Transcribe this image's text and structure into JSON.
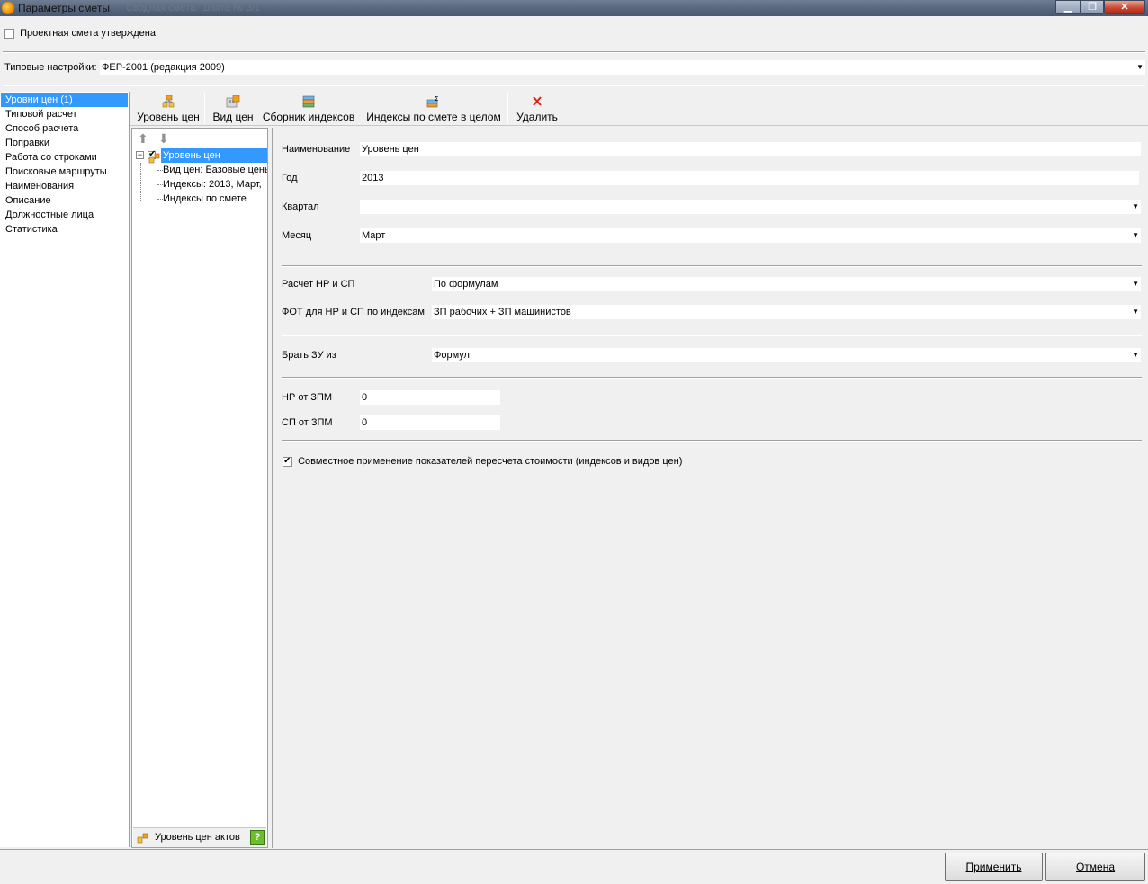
{
  "window": {
    "title": "Параметры сметы",
    "title_ghost": "Сводная смета. Шахта № 3/1"
  },
  "approved": {
    "label": "Проектная смета утверждена",
    "checked": false
  },
  "typical_settings": {
    "label": "Типовые настройки:",
    "value": "ФЕР-2001 (редакция 2009)"
  },
  "nav": {
    "items": [
      "Уровни цен (1)",
      "Типовой расчет",
      "Способ расчета",
      "Поправки",
      "Работа со строками",
      "Поисковые маршруты",
      "Наименования",
      "Описание",
      "Должностные лица",
      "Статистика"
    ]
  },
  "toolbar": {
    "price_level": "Уровень цен",
    "price_type": "Вид цен",
    "index_collection": "Сборник индексов",
    "indices_whole": "Индексы по смете в целом",
    "delete": "Удалить"
  },
  "tree": {
    "root": "Уровень цен",
    "children": [
      "Вид цен: Базовые цены",
      "Индексы: 2013, Март,",
      "Индексы по смете"
    ],
    "footer": "Уровень цен актов"
  },
  "form": {
    "name_label": "Наименование",
    "name_value": "Уровень цен",
    "year_label": "Год",
    "year_value": "2013",
    "quarter_label": "Квартал",
    "quarter_value": "",
    "month_label": "Месяц",
    "month_value": "Март",
    "nr_sp_label": "Расчет НР и СП",
    "nr_sp_value": "По формулам",
    "fot_label": "ФОТ для НР и СП по индексам",
    "fot_value": "ЗП рабочих + ЗП машинистов",
    "zu_label": "Брать ЗУ из",
    "zu_value": "Формул",
    "nr_zpm_label": "НР от ЗПМ",
    "nr_zpm_value": "0",
    "sp_zpm_label": "СП от ЗПМ",
    "sp_zpm_value": "0",
    "joint_label": "Совместное применение показателей пересчета стоимости (индексов и видов цен)",
    "joint_checked": true
  },
  "buttons": {
    "apply": "Применить",
    "cancel": "Отмена"
  }
}
